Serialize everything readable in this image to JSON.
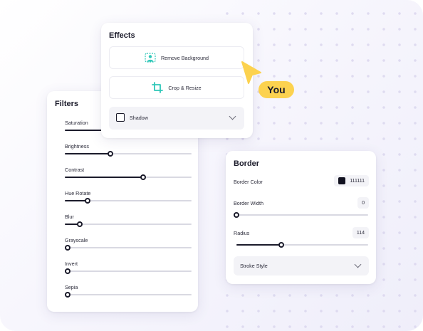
{
  "filters": {
    "title": "Filters",
    "sliders": [
      {
        "label": "Saturation",
        "value": 0.5
      },
      {
        "label": "Brightness",
        "value": 0.36
      },
      {
        "label": "Contrast",
        "value": 0.62
      },
      {
        "label": "Hue Rotate",
        "value": 0.18
      },
      {
        "label": "Blur",
        "value": 0.12
      },
      {
        "label": "Grayscale",
        "value": 0.02
      },
      {
        "label": "Invert",
        "value": 0.02
      },
      {
        "label": "Sepia",
        "value": 0.02
      }
    ]
  },
  "effects": {
    "title": "Effects",
    "remove_background": {
      "label": "Remove Background",
      "icon": "remove-background-icon"
    },
    "crop_resize": {
      "label": "Crop & Resize",
      "icon": "crop-icon"
    },
    "shadow": {
      "label": "Shadow",
      "checked": false
    }
  },
  "cursor": {
    "label": "You",
    "color": "#fcd24f"
  },
  "border": {
    "title": "Border",
    "color": {
      "label": "Border Color",
      "value": "111111",
      "swatch": "#11111f"
    },
    "width": {
      "label": "Border Width",
      "value": "0",
      "level": 0.0
    },
    "radius": {
      "label": "Radius",
      "value": "114",
      "level": 0.34
    },
    "stroke_style": {
      "label": "Stroke Style"
    }
  },
  "colors": {
    "accent_teal": "#2ec7b8",
    "track": "#d9d9e2",
    "fill": "#1b1b2b"
  }
}
